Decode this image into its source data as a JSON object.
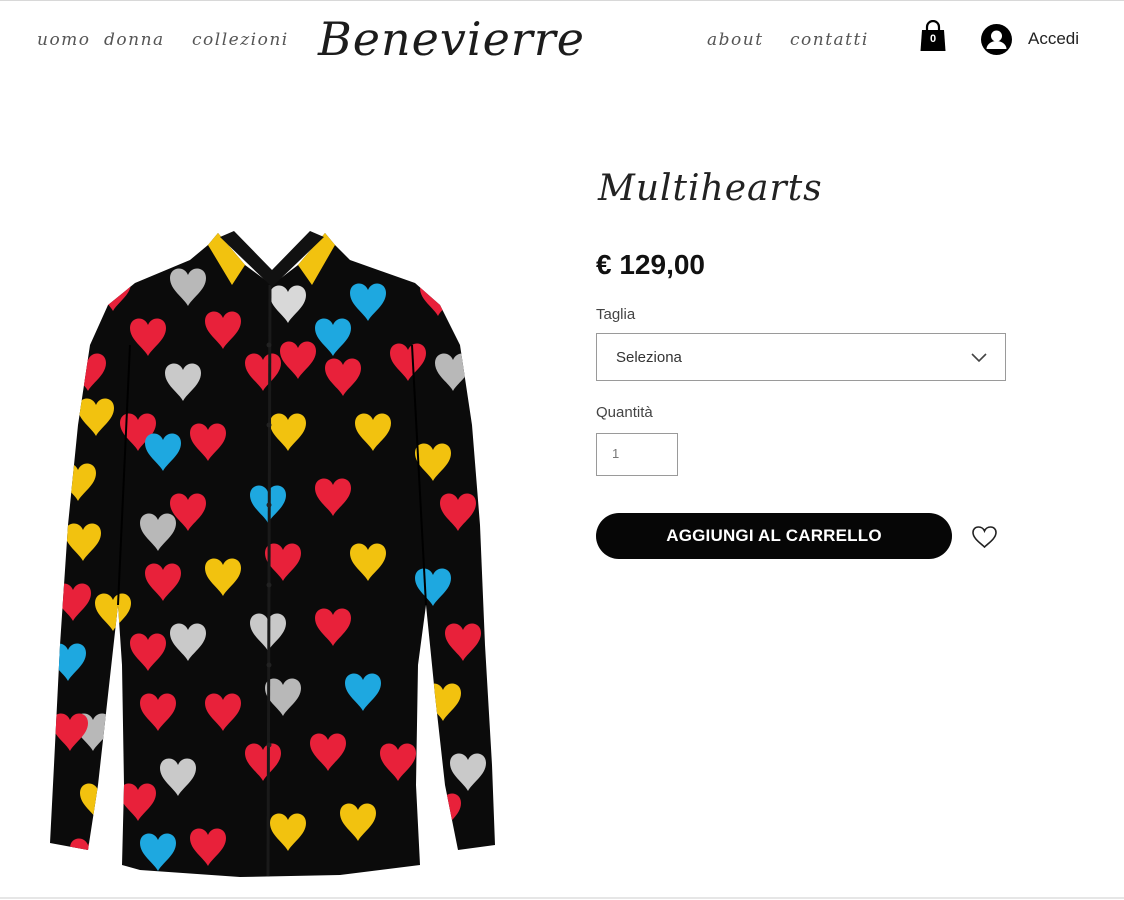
{
  "header": {
    "nav_left": [
      "uomo",
      "donna",
      "collezioni"
    ],
    "logo": "Benevierre",
    "nav_right": [
      "about",
      "contatti"
    ],
    "cart_count": "0",
    "login_label": "Accedi"
  },
  "product": {
    "title": "Multihearts",
    "price": "€ 129,00",
    "size_label": "Taglia",
    "size_placeholder": "Seleziona",
    "quantity_label": "Quantità",
    "quantity_value": "1",
    "add_to_cart_label": "AGGIUNGI AL CARRELLO"
  },
  "colors": {
    "button_bg": "#060606",
    "heart_red": "#e8213a",
    "heart_blue": "#1ea8e0",
    "heart_yellow": "#f2c20f",
    "heart_silver": "#b8b8b8",
    "shirt_bg": "#0b0b0b"
  },
  "icons": [
    "shopping-bag-icon",
    "user-avatar-icon",
    "chevron-down-icon",
    "heart-outline-icon"
  ]
}
